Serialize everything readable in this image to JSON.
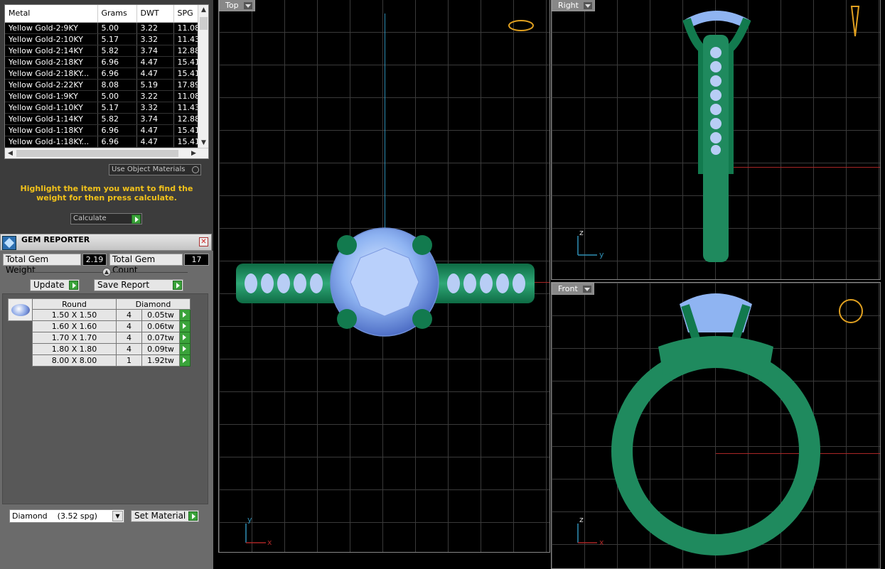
{
  "metal_table": {
    "headers": [
      "Metal",
      "Grams",
      "DWT",
      "SPG"
    ],
    "rows": [
      [
        "Yellow Gold-2:9KY",
        "5.00",
        "3.22",
        "11.08"
      ],
      [
        "Yellow Gold-2:10KY",
        "5.17",
        "3.32",
        "11.43"
      ],
      [
        "Yellow Gold-2:14KY",
        "5.82",
        "3.74",
        "12.88"
      ],
      [
        "Yellow Gold-2:18KY",
        "6.96",
        "4.47",
        "15.41"
      ],
      [
        "Yellow Gold-2:18KY...",
        "6.96",
        "4.47",
        "15.41"
      ],
      [
        "Yellow Gold-2:22KY",
        "8.08",
        "5.19",
        "17.89"
      ],
      [
        "Yellow Gold-1:9KY",
        "5.00",
        "3.22",
        "11.08"
      ],
      [
        "Yellow Gold-1:10KY",
        "5.17",
        "3.32",
        "11.43"
      ],
      [
        "Yellow Gold-1:14KY",
        "5.82",
        "3.74",
        "12.88"
      ],
      [
        "Yellow Gold-1:18KY",
        "6.96",
        "4.47",
        "15.41"
      ],
      [
        "Yellow Gold-1:18KY...",
        "6.96",
        "4.47",
        "15.41"
      ]
    ]
  },
  "use_object_materials_label": "Use Object Materials",
  "highlight_message": "Highlight the item you want to find the weight for then press calculate.",
  "calculate_label": "Calculate",
  "gem_reporter": {
    "title": "GEM REPORTER",
    "total_gem_weight_label": "Total Gem Weight",
    "total_gem_weight": "2.19",
    "total_gem_count_label": "Total Gem Count",
    "total_gem_count": "17",
    "update_label": "Update",
    "save_report_label": "Save Report",
    "columns": [
      "Round",
      "Diamond"
    ],
    "rows": [
      {
        "size": "1.50 X 1.50",
        "count": "4",
        "weight": "0.05tw"
      },
      {
        "size": "1.60 X 1.60",
        "count": "4",
        "weight": "0.06tw"
      },
      {
        "size": "1.70 X 1.70",
        "count": "4",
        "weight": "0.07tw"
      },
      {
        "size": "1.80 X 1.80",
        "count": "4",
        "weight": "0.09tw"
      },
      {
        "size": "8.00 X 8.00",
        "count": "1",
        "weight": "1.92tw"
      }
    ],
    "material_select_value": "Diamond    (3.52 spg)",
    "set_material_label": "Set Material"
  },
  "viewports": {
    "top": {
      "label": "Top",
      "axis_x": "x",
      "axis_y": "y"
    },
    "right": {
      "label": "Right",
      "axis_y": "y",
      "axis_z": "z"
    },
    "front": {
      "label": "Front",
      "axis_x": "x",
      "axis_z": "z"
    }
  },
  "colors": {
    "metal_green": "#1f8a5e",
    "gem_blue": "#8fb4f2",
    "accent_yellow": "#f2c21a",
    "go_green": "#3aa33a"
  }
}
